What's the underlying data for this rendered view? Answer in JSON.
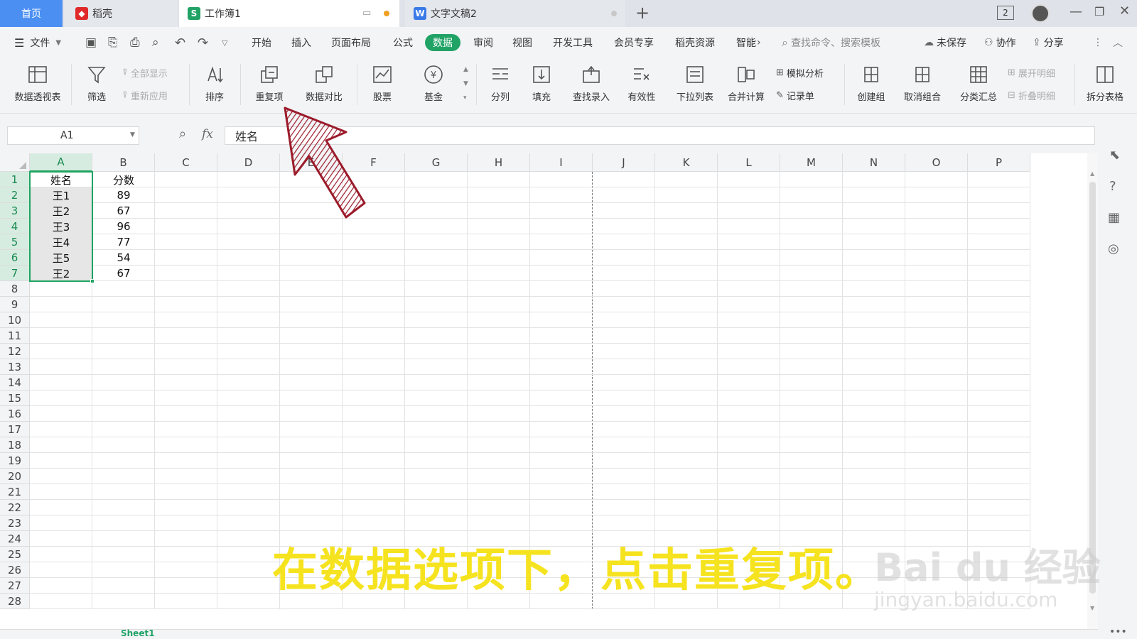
{
  "tabs": {
    "home": "首页",
    "docer": "稻壳",
    "workbook": "工作簿1",
    "document": "文字文稿2",
    "badge": "2"
  },
  "menu": {
    "file": "文件",
    "items": [
      "开始",
      "插入",
      "页面布局",
      "公式",
      "数据",
      "审阅",
      "视图",
      "开发工具",
      "会员专享",
      "稻壳资源",
      "智能"
    ],
    "active": "数据",
    "search_placeholder": "查找命令、搜索模板",
    "unsaved": "未保存",
    "collab": "协作",
    "share": "分享"
  },
  "ribbon": {
    "pivot": "数据透视表",
    "filter": "筛选",
    "show_all": "全部显示",
    "reapply": "重新应用",
    "sort": "排序",
    "duplicates": "重复项",
    "compare": "数据对比",
    "stock": "股票",
    "fund": "基金",
    "split": "分列",
    "fill": "填充",
    "lookup": "查找录入",
    "validity": "有效性",
    "dropdown": "下拉列表",
    "consolidate": "合并计算",
    "whatif": "模拟分析",
    "record": "记录单",
    "group": "创建组",
    "ungroup": "取消组合",
    "subtotal": "分类汇总",
    "expand": "展开明细",
    "collapse": "折叠明细",
    "split_table": "拆分表格"
  },
  "formula_bar": {
    "cell_ref": "A1",
    "fx": "fx",
    "content": "姓名"
  },
  "columns": [
    "A",
    "B",
    "C",
    "D",
    "E",
    "F",
    "G",
    "H",
    "I",
    "J",
    "K",
    "L",
    "M",
    "N",
    "O",
    "P"
  ],
  "rows": [
    "1",
    "2",
    "3",
    "4",
    "5",
    "6",
    "7",
    "8",
    "9",
    "10",
    "11",
    "12",
    "13",
    "14",
    "15",
    "16",
    "17",
    "18",
    "19",
    "20",
    "21",
    "22",
    "23",
    "24",
    "25",
    "26",
    "27",
    "28"
  ],
  "sheet": {
    "header": [
      "姓名",
      "分数"
    ],
    "data": [
      [
        "王1",
        "89"
      ],
      [
        "王2",
        "67"
      ],
      [
        "王3",
        "96"
      ],
      [
        "王4",
        "77"
      ],
      [
        "王5",
        "54"
      ],
      [
        "王2",
        "67"
      ]
    ]
  },
  "sheet_tab": "Sheet1",
  "caption": "在数据选项下，点击重复项。",
  "watermark": {
    "main": "Bai du 经验",
    "url": "jingyan.baidu.com"
  },
  "colors": {
    "accent": "#21a366",
    "selection": "#1fa462",
    "caption": "#f6e31f",
    "arrow": "#9b1b2b"
  }
}
